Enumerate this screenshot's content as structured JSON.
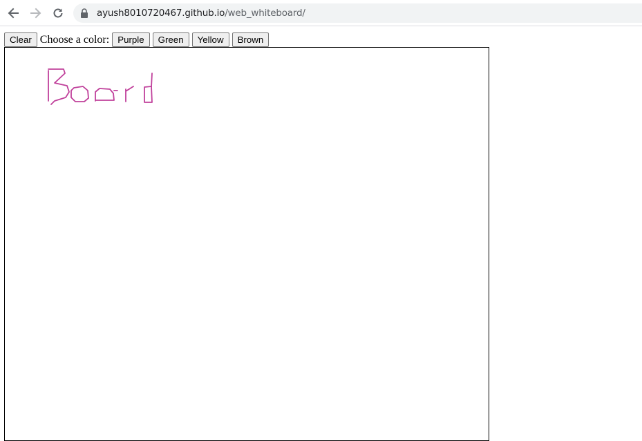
{
  "browser": {
    "url_host": "ayush8010720467.github.io",
    "url_path": "/web_whiteboard/",
    "icons": [
      "back-arrow-icon",
      "forward-arrow-icon",
      "reload-icon",
      "lock-icon"
    ]
  },
  "toolbar": {
    "clear_label": "Clear",
    "color_prompt": "Choose a color:",
    "colors": [
      {
        "label": "Purple"
      },
      {
        "label": "Green"
      },
      {
        "label": "Yellow"
      },
      {
        "label": "Brown"
      }
    ]
  },
  "canvas": {
    "stroke_color": "#c0409b",
    "drawn_text": "Board"
  }
}
